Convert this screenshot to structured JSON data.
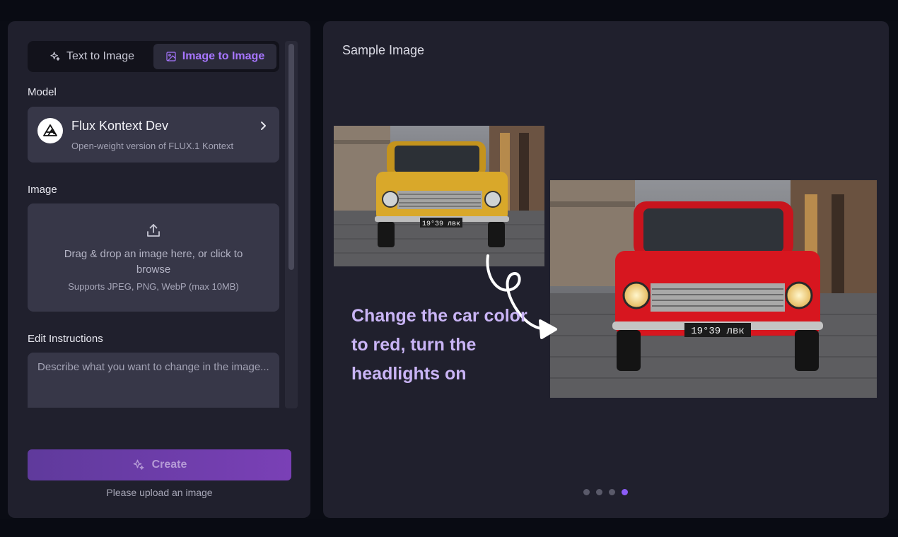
{
  "tabs": [
    {
      "label": "Text to Image",
      "icon": "sparkle-icon",
      "active": false
    },
    {
      "label": "Image to Image",
      "icon": "image-icon",
      "active": true
    }
  ],
  "model": {
    "section_label": "Model",
    "name": "Flux Kontext Dev",
    "description": "Open-weight version of FLUX.1 Kontext",
    "icon": "flux-logo-icon"
  },
  "image_upload": {
    "section_label": "Image",
    "main_text": "Drag & drop an image here, or click to browse",
    "sub_text": "Supports JPEG, PNG, WebP (max 10MB)",
    "icon": "upload-icon"
  },
  "edit_instructions": {
    "section_label": "Edit Instructions",
    "placeholder": "Describe what you want to change in the image...",
    "value": ""
  },
  "create": {
    "label": "Create",
    "helper": "Please upload an image",
    "icon": "sparkle-icon"
  },
  "sample": {
    "title": "Sample Image",
    "caption": "Change the car color to red, turn the headlights on",
    "before_car_color": "#d9a82a",
    "after_car_color": "#d7161f",
    "plate_text": "19°39 лвк",
    "dots_count": 4,
    "active_dot": 3
  },
  "colors": {
    "accent": "#a776ff",
    "panel_bg": "#20202d",
    "card_bg": "#373748",
    "button_gradient_start": "#5f3a9c",
    "button_gradient_end": "#7a40b6"
  }
}
